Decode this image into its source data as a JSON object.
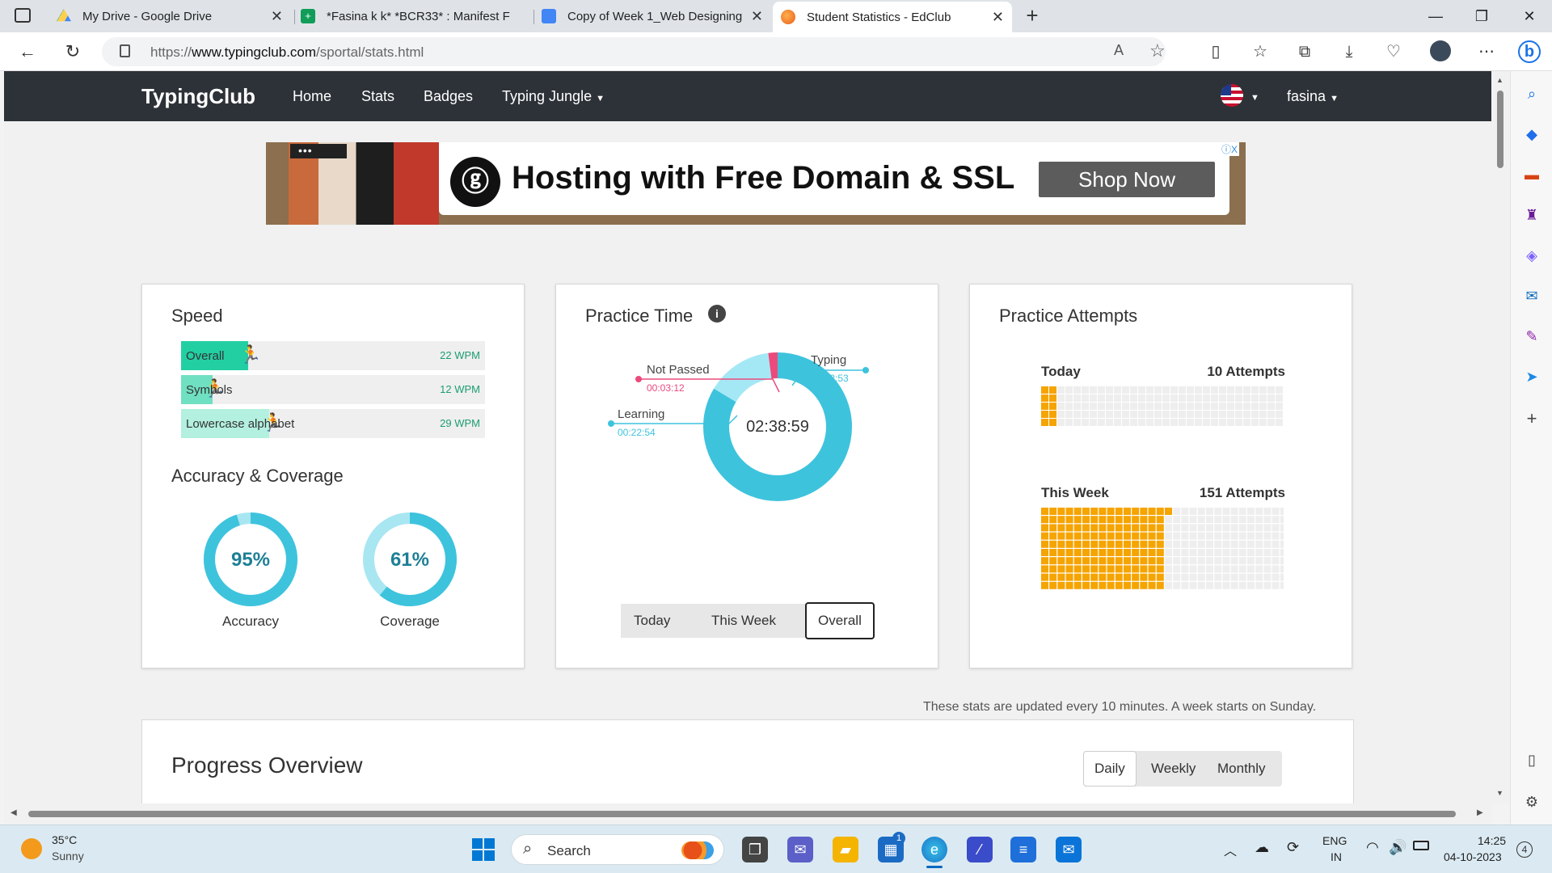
{
  "browser": {
    "tabs": [
      {
        "title": "My Drive - Google Drive",
        "active": false,
        "icon": "google-drive-icon"
      },
      {
        "title": "*Fasina k k* *BCR33* : Manifest F",
        "active": false,
        "icon": "google-sheets-icon"
      },
      {
        "title": "Copy of Week 1_Web Designing",
        "active": false,
        "icon": "google-docs-icon"
      },
      {
        "title": "Student Statistics - EdClub",
        "active": true,
        "icon": "edclub-icon"
      }
    ],
    "url_prefix": "https://",
    "url_domain": "www.typingclub.com",
    "url_path": "/sportal/stats.html"
  },
  "site": {
    "brand": "TypingClub",
    "nav": [
      "Home",
      "Stats",
      "Badges",
      "Typing Jungle"
    ],
    "user": "fasina"
  },
  "ad": {
    "dots": "•••",
    "title": "Hosting with Free Domain & SSL",
    "cta": "Shop Now",
    "info": "ⓘX"
  },
  "speed": {
    "title": "Speed",
    "rows": [
      {
        "label": "Overall",
        "value": "22 WPM",
        "fraction": 0.22,
        "color": "#22cfa3"
      },
      {
        "label": "Symbols",
        "value": "12 WPM",
        "fraction": 0.105,
        "color": "#6fe0c1"
      },
      {
        "label": "Lowercase alphabet",
        "value": "29 WPM",
        "fraction": 0.29,
        "color": "#b3f0df"
      }
    ]
  },
  "accuracy": {
    "title": "Accuracy & Coverage",
    "accuracy_value": "95%",
    "accuracy_label": "Accuracy",
    "accuracy_fraction": 0.95,
    "coverage_value": "61%",
    "coverage_label": "Coverage",
    "coverage_fraction": 0.61,
    "ring_color": "#3ec3dd",
    "ring_light": "#a8e6f2"
  },
  "practice_time": {
    "title": "Practice Time",
    "total": "02:38:59",
    "segments": [
      {
        "name": "Typing",
        "time": "02:12:53",
        "seconds": 7973,
        "color": "#3ec3dd"
      },
      {
        "name": "Learning",
        "time": "00:22:54",
        "seconds": 1374,
        "color": "#a5e8f5"
      },
      {
        "name": "Not Passed",
        "time": "00:03:12",
        "seconds": 192,
        "color": "#ec4a7c"
      }
    ],
    "periods": [
      "Today",
      "This Week",
      "Overall"
    ],
    "selected_period": "Overall"
  },
  "attempts": {
    "title": "Practice Attempts",
    "today_label": "Today",
    "today_value": "10 Attempts",
    "today_count": 10,
    "week_label": "This Week",
    "week_value": "151 Attempts",
    "week_count": 151,
    "filled_color": "#f5a400",
    "empty_color": "#eeeeee"
  },
  "note": "These stats are updated every 10 minutes. A week starts on Sunday.",
  "progress": {
    "title": "Progress Overview",
    "options": [
      "Daily",
      "Weekly",
      "Monthly"
    ],
    "selected": "Daily"
  },
  "taskbar": {
    "weather_temp": "35°C",
    "weather_desc": "Sunny",
    "search_label": "Search",
    "lang1": "ENG",
    "lang2": "IN",
    "time": "14:25",
    "date": "04-10-2023",
    "notif": "4",
    "store_badge": "1"
  }
}
